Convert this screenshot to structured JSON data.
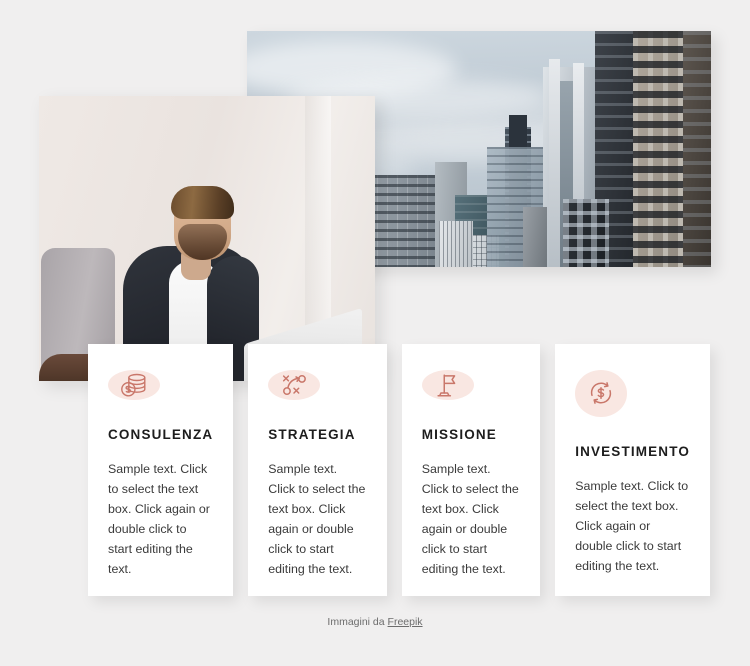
{
  "page": {
    "background_color": "#f0efef",
    "accent_color": "#c9776a",
    "icon_circle_color": "#f9e7e2",
    "card_background": "#ffffff"
  },
  "media": [
    {
      "name": "buildings-photo",
      "alt": "City skyline with modern office skyscrapers under an overcast sky"
    },
    {
      "name": "businessman-photo",
      "alt": "Bearded businessman in a dark blazer working on a laptop"
    }
  ],
  "cards": [
    {
      "icon": "coins-stack-icon",
      "title": "CONSULENZA",
      "text": "Sample text. Click to select the text box. Click again or double click to start editing the text."
    },
    {
      "icon": "strategy-playbook-icon",
      "title": "STRATEGIA",
      "text": "Sample text. Click to select the text box. Click again or double click to start editing the text."
    },
    {
      "icon": "flag-icon",
      "title": "MISSIONE",
      "text": "Sample text. Click to select the text box. Click again or double click to start editing the text."
    },
    {
      "icon": "money-exchange-icon",
      "title": "INVESTIMENTO",
      "text": "Sample text. Click to select the text box. Click again or double click to start editing the text."
    }
  ],
  "footer": {
    "prefix": "Immagini da",
    "link_label": "Freepik"
  }
}
